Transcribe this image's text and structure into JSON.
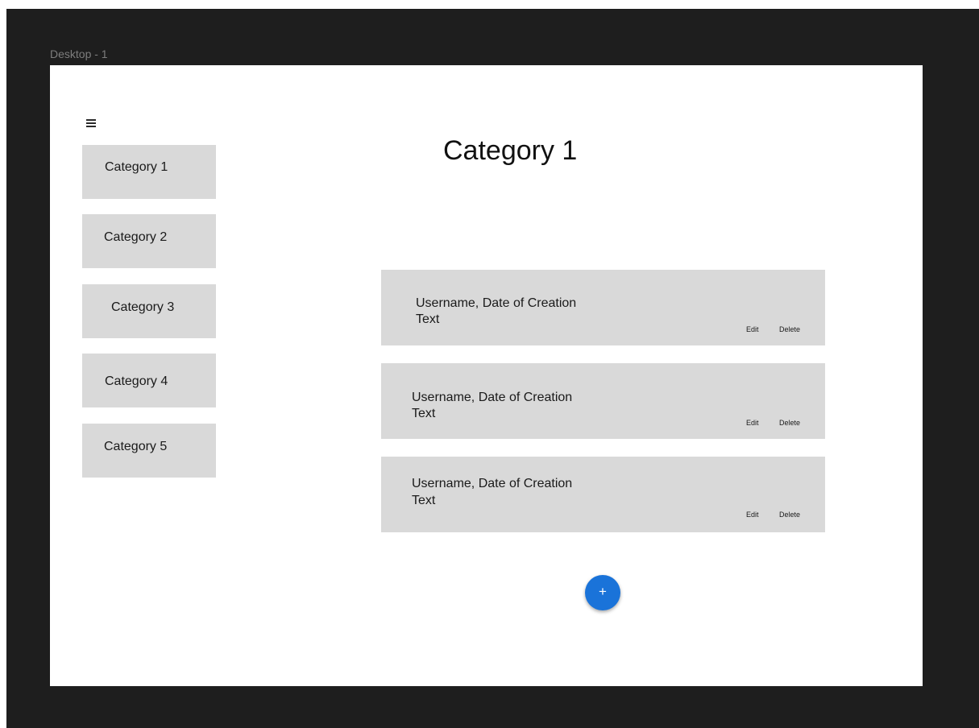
{
  "frame": {
    "label": "Desktop - 1"
  },
  "sidebar": {
    "categories": [
      {
        "label": "Category 1"
      },
      {
        "label": "Category 2"
      },
      {
        "label": "Category 3"
      },
      {
        "label": "Category 4"
      },
      {
        "label": "Category 5"
      }
    ]
  },
  "main": {
    "title": "Category 1",
    "posts": [
      {
        "meta": "Username, Date of Creation",
        "text": "Text",
        "edit_label": "Edit",
        "delete_label": "Delete"
      },
      {
        "meta": "Username, Date of Creation",
        "text": "Text",
        "edit_label": "Edit",
        "delete_label": "Delete"
      },
      {
        "meta": "Username, Date of Creation",
        "text": "Text",
        "edit_label": "Edit",
        "delete_label": "Delete"
      }
    ],
    "fab_label": "+"
  },
  "colors": {
    "canvas": "#1e1e1e",
    "card": "#d9d9d9",
    "accent": "#1a73d9"
  },
  "icons": {
    "menu": "hamburger-menu-icon",
    "add": "plus-icon"
  }
}
